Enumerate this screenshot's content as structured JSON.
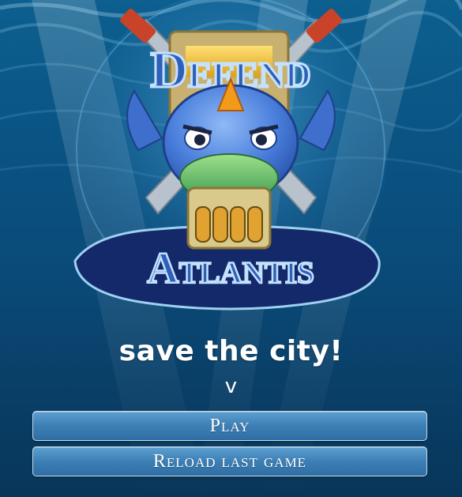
{
  "logo": {
    "title_line1": "Defend",
    "title_line2": "Atlantis"
  },
  "tagline": "save the city!",
  "version": "v",
  "buttons": {
    "play": "Play",
    "reload": "Reload last game"
  },
  "colors": {
    "ocean_top": "#0c5f8f",
    "ocean_bottom": "#08365a",
    "island": "#152a6a",
    "logo_text": "#2f5fb8",
    "creature": "#3f78d8",
    "horn": "#f29a1a",
    "dome": "#5fbf6a",
    "button_fill": "#3c7fb5"
  }
}
